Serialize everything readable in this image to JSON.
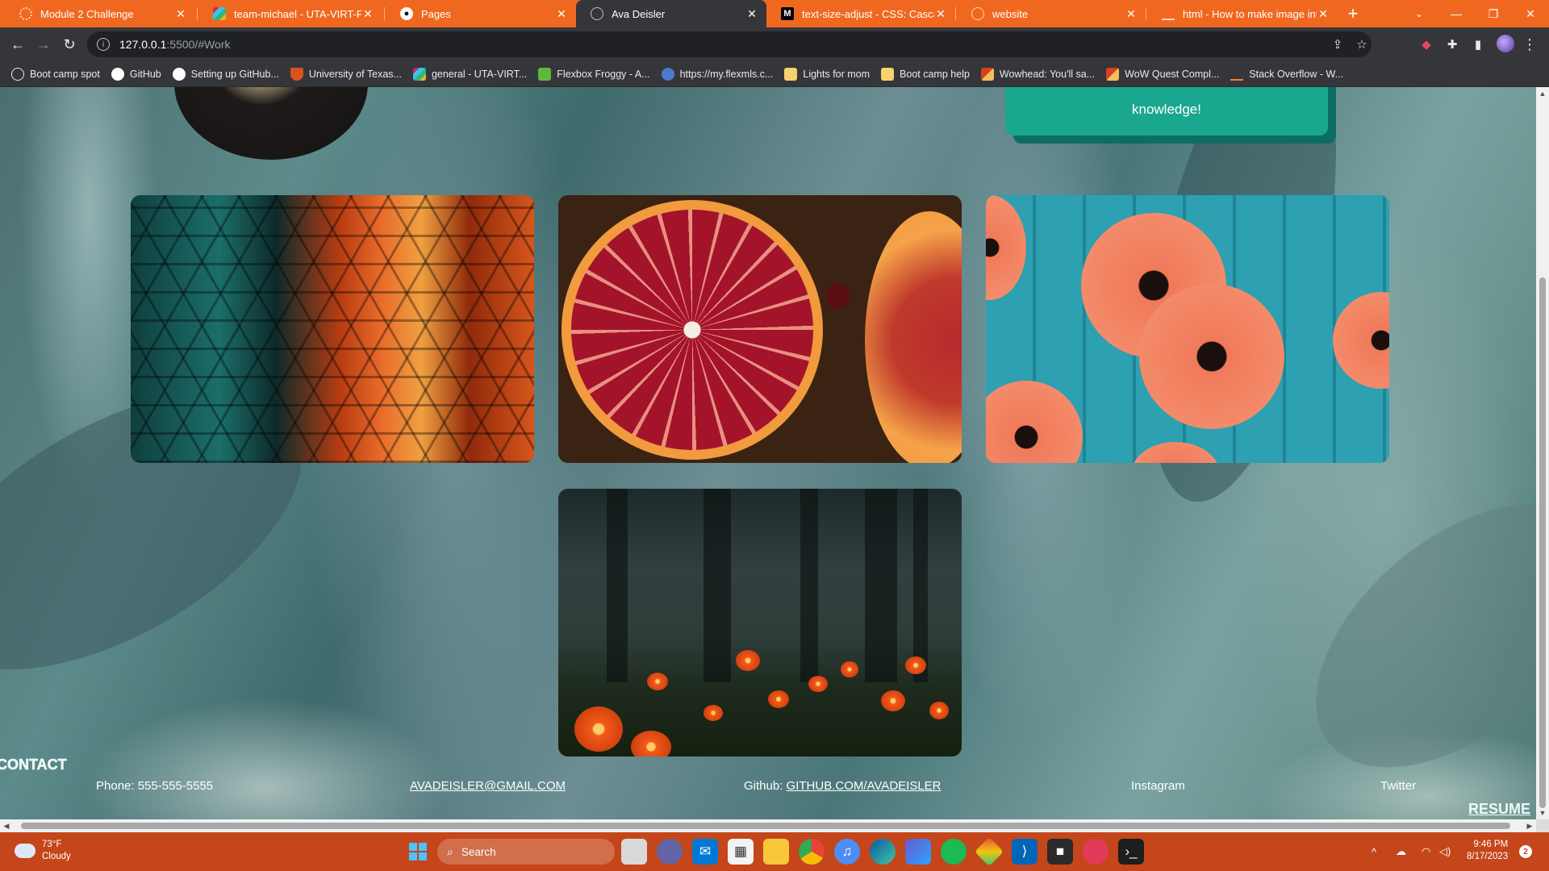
{
  "browser": {
    "tabs": [
      {
        "title": "Module 2 Challenge",
        "icon": "spinner-icon",
        "active": false
      },
      {
        "title": "team-michael - UTA-VIRT-FSF-P",
        "icon": "slack-icon",
        "active": false
      },
      {
        "title": "Pages",
        "icon": "github-icon",
        "active": false
      },
      {
        "title": "Ava Deisler",
        "icon": "globe-icon",
        "active": true
      },
      {
        "title": "text-size-adjust - CSS: Cascadin",
        "icon": "mdn-icon",
        "active": false
      },
      {
        "title": "website",
        "icon": "globe-icon",
        "active": false
      },
      {
        "title": "html - How to make image into",
        "icon": "stackoverflow-icon",
        "active": false
      }
    ],
    "new_tab": "+",
    "url_host": "127.0.0.1",
    "url_path": ":5500/#Work",
    "bookmarks": [
      {
        "label": "Boot camp spot",
        "icon": "globe-icon"
      },
      {
        "label": "GitHub",
        "icon": "github-icon"
      },
      {
        "label": "Setting up GitHub...",
        "icon": "github-icon"
      },
      {
        "label": "University of Texas...",
        "icon": "shield-icon"
      },
      {
        "label": "general - UTA-VIRT...",
        "icon": "slack-icon"
      },
      {
        "label": "Flexbox Froggy - A...",
        "icon": "frog-icon"
      },
      {
        "label": "https://my.flexmls.c...",
        "icon": "pin-icon"
      },
      {
        "label": "Lights for mom",
        "icon": "folder-icon"
      },
      {
        "label": "Boot camp help",
        "icon": "folder-icon"
      },
      {
        "label": "Wowhead: You'll sa...",
        "icon": "wowhead-icon"
      },
      {
        "label": "WoW Quest Compl...",
        "icon": "wowhead-icon"
      },
      {
        "label": "Stack Overflow - W...",
        "icon": "stackoverflow-icon"
      }
    ]
  },
  "page": {
    "about_card_text": "knowledge!",
    "work_images": [
      "geometric-glass-tiles-image",
      "blood-orange-image",
      "papaya-slices-image",
      "forest-flowers-image"
    ],
    "contact_title": "CONTACT",
    "phone": "Phone: 555-555-5555",
    "email": "AVADEISLER@GMAIL.COM",
    "github_label": "Github: ",
    "github_link": "GITHUB.COM/AVADEISLER",
    "instagram": "Instagram",
    "twitter": "Twitter",
    "resume": "RESUME"
  },
  "taskbar": {
    "temperature": "73°F",
    "condition": "Cloudy",
    "search_label": "Search",
    "time": "9:46 PM",
    "date": "8/17/2023",
    "notifications": "2"
  },
  "colors": {
    "tabstrip": "#f06820",
    "taskbar": "#c4461a",
    "about_card": "#1aa78f"
  }
}
